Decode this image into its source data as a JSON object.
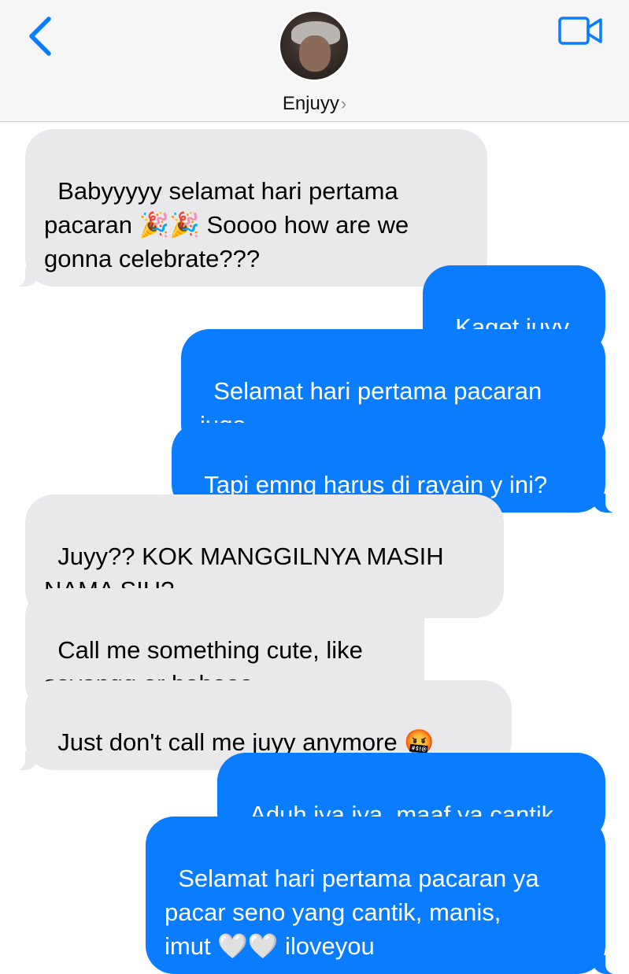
{
  "header": {
    "contact_name": "Enjuyy",
    "chevron": "›",
    "icons": {
      "back": "chevron-left-icon",
      "video": "video-camera-icon"
    },
    "accent_color": "#0a7cff"
  },
  "messages": [
    {
      "sender": "contact",
      "text": "Babyyyyy selamat hari pertama\npacaran 🎉🎉 Soooo how are we\ngonna celebrate???"
    },
    {
      "sender": "me",
      "text": "Kaget juyy.."
    },
    {
      "sender": "me",
      "text": "Selamat hari pertama pacaran\njuga.."
    },
    {
      "sender": "me",
      "text": "Tapi emng harus di rayain y ini?"
    },
    {
      "sender": "contact",
      "text": "Juyy?? KOK MANGGILNYA MASIH\nNAMA SIH?"
    },
    {
      "sender": "contact",
      "text": "Call me something cute, like\nsayangg or babeee"
    },
    {
      "sender": "contact",
      "text": "Just don't call me juyy anymore 🤬"
    },
    {
      "sender": "me",
      "text": "Aduh iya iya, maaf ya cantik"
    },
    {
      "sender": "me",
      "text": "Selamat hari pertama pacaran ya\npacar seno yang cantik, manis,\nimut 🤍🤍 iloveyou"
    }
  ],
  "colors": {
    "incoming_bubble": "#e9e9eb",
    "outgoing_bubble": "#0a7cff"
  }
}
